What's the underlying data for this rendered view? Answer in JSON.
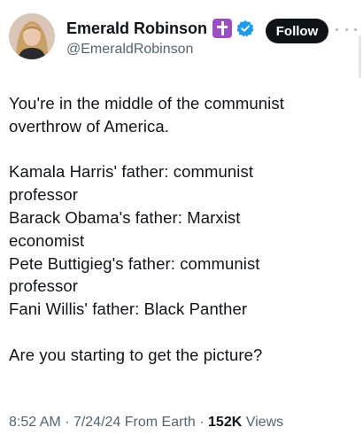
{
  "author": {
    "display_name": "Emerald Robinson",
    "handle": "@EmeraldRobinson"
  },
  "actions": {
    "follow_label": "Follow"
  },
  "tweet": {
    "lines": [
      "You're in the middle of the communist",
      "overthrow of America.",
      "",
      "Kamala Harris' father: communist",
      "professor",
      "Barack Obama's father: Marxist",
      "economist",
      "Pete Buttigieg's father: communist",
      "professor",
      "Fani Willis' father: Black Panther",
      "",
      "Are you starting to get the picture?"
    ]
  },
  "meta": {
    "time": "8:52 AM",
    "date": "7/24/24",
    "source": "From Earth",
    "views_count": "152K",
    "views_label": "Views",
    "separator": "·"
  },
  "colors": {
    "text_primary": "#0f1419",
    "text_secondary": "#536471",
    "verified_blue": "#1d9bf0",
    "badge_purple": "#9c4fc4"
  },
  "icons": {
    "badge": "cross-badge-icon",
    "verified": "verified-check-icon",
    "more": "more-horizontal-icon"
  }
}
